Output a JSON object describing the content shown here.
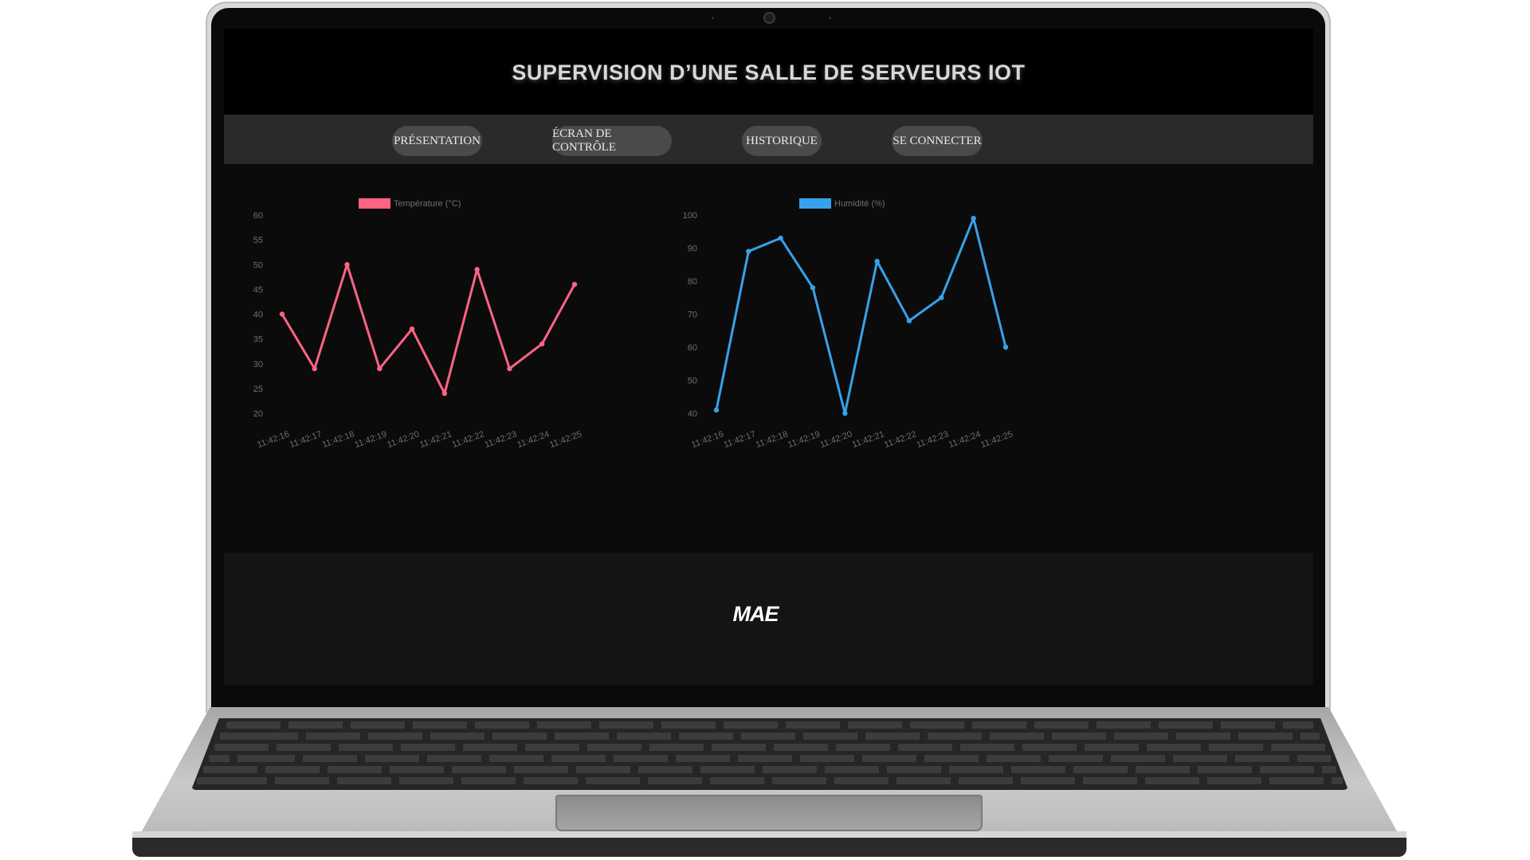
{
  "site": {
    "title": "SUPERVISION D’UNE SALLE DE SERVEURS IOT"
  },
  "nav": {
    "items": [
      {
        "label": "PRÉSENTATION"
      },
      {
        "label": "ÉCRAN DE CONTRÔLE"
      },
      {
        "label": "HISTORIQUE"
      },
      {
        "label": "SE CONNECTER"
      }
    ]
  },
  "colors": {
    "temperature": "#ff6384",
    "humidity": "#36a2eb"
  },
  "logo": {
    "text": "MAE"
  },
  "chart_data": [
    {
      "type": "line",
      "title": "",
      "x": [
        "11:42:16",
        "11:42:17",
        "11:42:18",
        "11:42:19",
        "11:42:20",
        "11:42:21",
        "11:42:22",
        "11:42:23",
        "11:42:24",
        "11:42:25"
      ],
      "series": [
        {
          "name": "Température (°C)",
          "values": [
            40,
            29,
            50,
            29,
            37,
            24,
            49,
            29,
            34,
            46
          ]
        }
      ],
      "ylim": [
        20,
        60
      ],
      "yticks": [
        20,
        25,
        30,
        35,
        40,
        45,
        50,
        55,
        60
      ],
      "grid": false,
      "legend": "top"
    },
    {
      "type": "line",
      "title": "",
      "x": [
        "11:42:16",
        "11:42:17",
        "11:42:18",
        "11:42:19",
        "11:42:20",
        "11:42:21",
        "11:42:22",
        "11:42:23",
        "11:42:24",
        "11:42:25"
      ],
      "series": [
        {
          "name": "Humidité (%)",
          "values": [
            41,
            89,
            93,
            78,
            40,
            86,
            68,
            75,
            99,
            60
          ]
        }
      ],
      "ylim": [
        40,
        100
      ],
      "yticks": [
        40,
        50,
        60,
        70,
        80,
        90,
        100
      ],
      "grid": false,
      "legend": "top"
    }
  ]
}
